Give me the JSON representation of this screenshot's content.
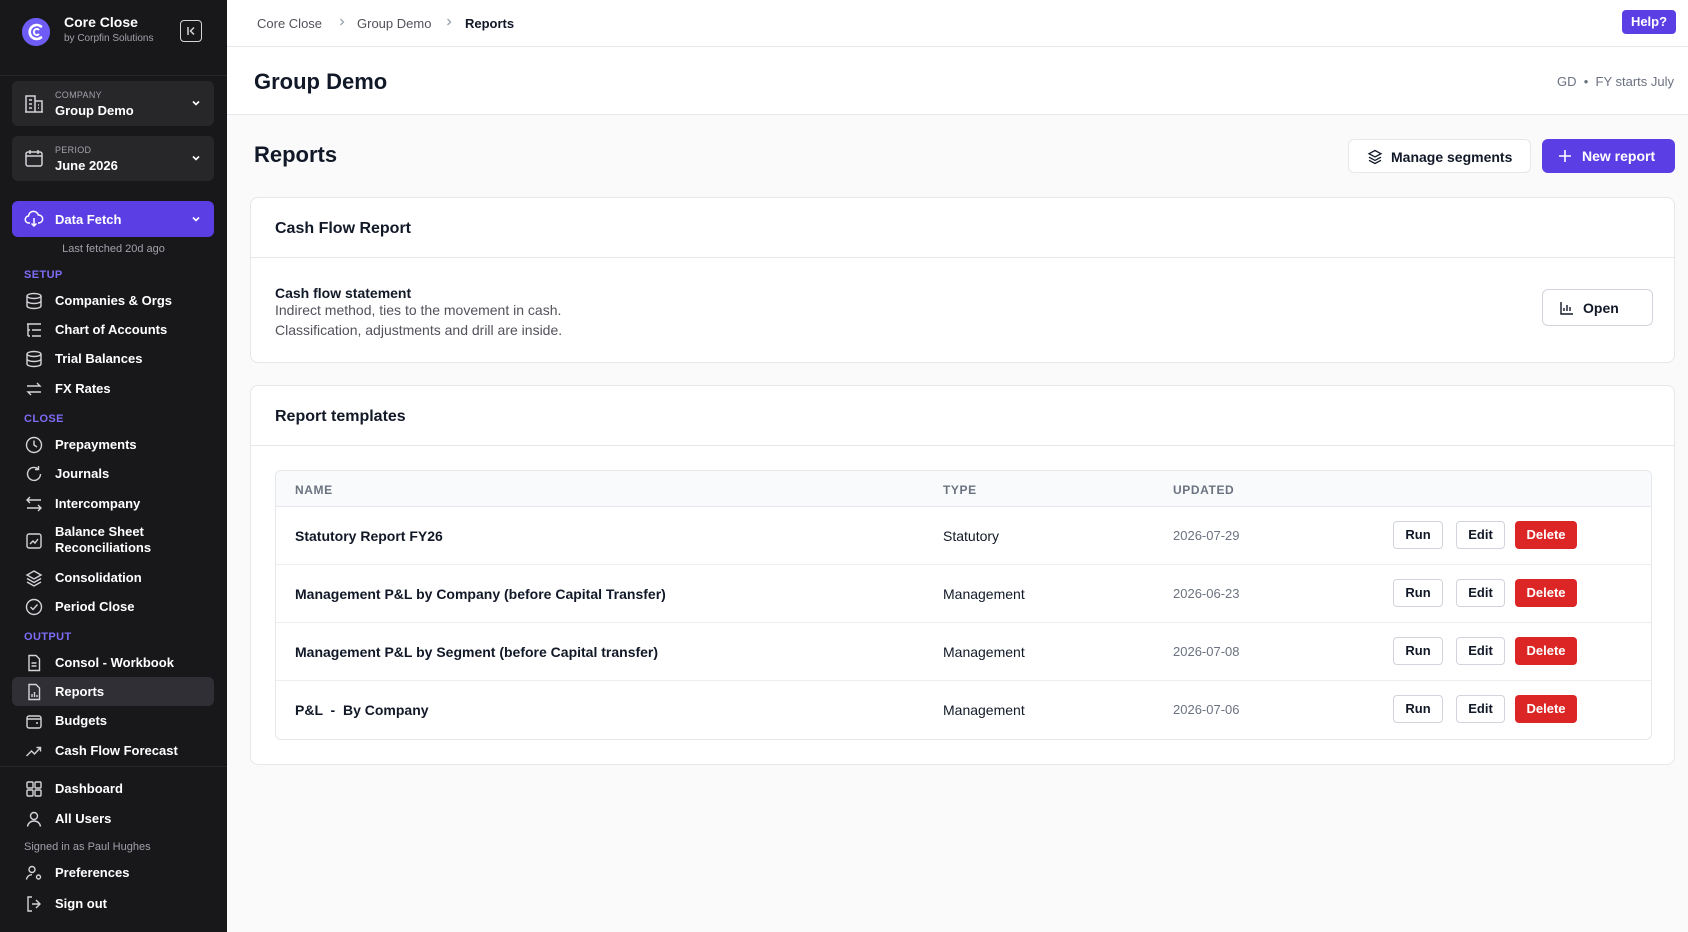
{
  "brand": {
    "name": "Core Close",
    "sub": "by Corpfin Solutions"
  },
  "company": {
    "label": "COMPANY",
    "value": "Group Demo"
  },
  "period": {
    "label": "PERIOD",
    "value": "June 2026"
  },
  "data_fetch": {
    "label": "Data Fetch",
    "note": "Last fetched 20d ago"
  },
  "sections": {
    "setup": "SETUP",
    "close": "CLOSE",
    "output": "OUTPUT"
  },
  "nav": {
    "companies": "Companies & Orgs",
    "chart_of_accounts": "Chart of Accounts",
    "trial_balances": "Trial Balances",
    "fx_rates": "FX Rates",
    "prepayments": "Prepayments",
    "journals": "Journals",
    "intercompany": "Intercompany",
    "bs_recs": "Balance Sheet Reconciliations",
    "consolidation": "Consolidation",
    "period_close": "Period Close",
    "consol_workbook": "Consol - Workbook",
    "reports": "Reports",
    "budgets": "Budgets",
    "cash_flow_forecast": "Cash Flow Forecast",
    "dashboard": "Dashboard",
    "all_users": "All Users",
    "preferences": "Preferences",
    "sign_out": "Sign out"
  },
  "signed_in": "Signed in as Paul Hughes",
  "breadcrumb": [
    "Core Close",
    "Group Demo",
    "Reports"
  ],
  "help": "Help?",
  "header": {
    "title": "Group Demo",
    "meta": "GD  •  FY starts July"
  },
  "reports": {
    "title": "Reports",
    "manage_segments": "Manage segments",
    "new_report": "New report"
  },
  "cash_flow": {
    "card_title": "Cash Flow Report",
    "name": "Cash flow statement",
    "desc1": "Indirect method, ties to the movement in cash.",
    "desc2": "Classification, adjustments and drill are inside.",
    "open": "Open"
  },
  "templates": {
    "card_title": "Report templates",
    "columns": [
      "NAME",
      "TYPE",
      "UPDATED"
    ],
    "actions": {
      "run": "Run",
      "edit": "Edit",
      "delete": "Delete"
    },
    "rows": [
      {
        "name": "Statutory Report FY26",
        "type": "Statutory",
        "updated": "2026-07-29"
      },
      {
        "name": "Management P&L by Company (before Capital Transfer)",
        "type": "Management",
        "updated": "2026-06-23"
      },
      {
        "name": "Management P&L by Segment (before Capital transfer)",
        "type": "Management",
        "updated": "2026-07-08"
      },
      {
        "name": "P&L  -  By Company",
        "type": "Management",
        "updated": "2026-07-06"
      }
    ]
  },
  "colors": {
    "accent": "#5b3fe4",
    "sidebar": "#18181b",
    "danger": "#dc2626"
  }
}
